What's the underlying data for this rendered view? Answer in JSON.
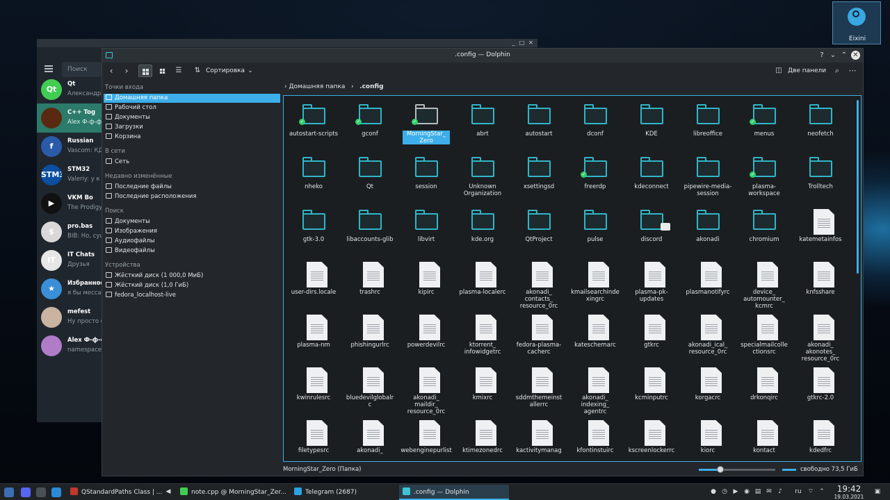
{
  "desktop": {
    "user_name": "Eixini"
  },
  "telegram": {
    "search_placeholder": "Поиск",
    "chats": [
      {
        "name": "Qt",
        "message": "Александр:",
        "avatar_text": "Qt",
        "color": "#41cd52"
      },
      {
        "name": "C++ Tog",
        "message": "Alex Ф-ф-ф",
        "avatar_text": "",
        "color": "#5a2a10"
      },
      {
        "name": "Russian",
        "message": "Vascom: КД",
        "avatar_text": "f",
        "color": "#2b5aa8"
      },
      {
        "name": "STM32",
        "message": "Valeriy: у к",
        "avatar_text": "STM32",
        "color": "#0a4fa0"
      },
      {
        "name": "VKM Bo",
        "message": "The Prodigy",
        "avatar_text": "▶",
        "color": "#111111"
      },
      {
        "name": "pro.bas",
        "message": "BIB: Но, суц",
        "avatar_text": "$",
        "color": "#d8d8d8"
      },
      {
        "name": "IT Chats",
        "message": "Друзья",
        "avatar_text": "IT",
        "color": "#e6e6e6"
      },
      {
        "name": "Избранное",
        "message": "я бы мессаг",
        "avatar_text": "★",
        "color": "#3a8fd6"
      },
      {
        "name": "mefest",
        "message": "Ну просто с",
        "avatar_text": "",
        "color": "#c8b4a0"
      },
      {
        "name": "Alex Ф-ф-ф",
        "message": "namespace",
        "avatar_text": "",
        "color": "#b07cc8"
      }
    ]
  },
  "dolphin": {
    "title": ".config — Dolphin",
    "sort_label": "Сортировка",
    "split_label": "Две панели",
    "breadcrumb": {
      "home": "Домашняя папка",
      "current": ".config"
    },
    "places": {
      "entry_points": "Точки входа",
      "items_main": [
        "Домашняя папка",
        "Рабочий стол",
        "Документы",
        "Загрузки",
        "Корзина"
      ],
      "network": "В сети",
      "items_network": [
        "Сеть"
      ],
      "recent": "Недавно изменённые",
      "items_recent": [
        "Последние файлы",
        "Последние расположения"
      ],
      "search": "Поиск",
      "items_search": [
        "Документы",
        "Изображения",
        "Аудиофайлы",
        "Видеофайлы"
      ],
      "devices": "Устройства",
      "items_devices": [
        "Жёсткий диск (1 000,0 МиБ)",
        "Жёсткий диск (1,0 ГиБ)",
        "fedora_localhost-live"
      ]
    },
    "status_text": "MorningStar_Zero (Папка)",
    "free_space": "свободно 73,5 ГиБ",
    "zoom_fraction": 0.28,
    "items": [
      {
        "name": "autostart-scripts",
        "type": "folder",
        "synced": true
      },
      {
        "name": "gconf",
        "type": "folder",
        "synced": true
      },
      {
        "name": "MorningStar_\nZero",
        "type": "folder",
        "synced": true,
        "selected": true
      },
      {
        "name": "abrt",
        "type": "folder"
      },
      {
        "name": "autostart",
        "type": "folder"
      },
      {
        "name": "dconf",
        "type": "folder"
      },
      {
        "name": "KDE",
        "type": "folder"
      },
      {
        "name": "libreoffice",
        "type": "folder"
      },
      {
        "name": "menus",
        "type": "folder",
        "synced": true
      },
      {
        "name": "neofetch",
        "type": "folder"
      },
      {
        "name": "nheko",
        "type": "folder"
      },
      {
        "name": "Qt",
        "type": "folder"
      },
      {
        "name": "session",
        "type": "folder"
      },
      {
        "name": "Unknown\nOrganization",
        "type": "folder"
      },
      {
        "name": "xsettingsd",
        "type": "folder"
      },
      {
        "name": "freerdp",
        "type": "folder",
        "synced": true
      },
      {
        "name": "kdeconnect",
        "type": "folder"
      },
      {
        "name": "pipewire-media-\nsession",
        "type": "folder"
      },
      {
        "name": "plasma-\nworkspace",
        "type": "folder",
        "synced": true
      },
      {
        "name": "Trolltech",
        "type": "folder"
      },
      {
        "name": "gtk-3.0",
        "type": "folder"
      },
      {
        "name": "libaccounts-glib",
        "type": "folder"
      },
      {
        "name": "libvirt",
        "type": "folder"
      },
      {
        "name": "kde.org",
        "type": "folder"
      },
      {
        "name": "QtProject",
        "type": "folder"
      },
      {
        "name": "pulse",
        "type": "folder"
      },
      {
        "name": "discord",
        "type": "folder",
        "discord": true
      },
      {
        "name": "akonadi",
        "type": "folder"
      },
      {
        "name": "chromium",
        "type": "folder"
      },
      {
        "name": "katemetainfos",
        "type": "file"
      },
      {
        "name": "user-dirs.locale",
        "type": "file"
      },
      {
        "name": "trashrc",
        "type": "file"
      },
      {
        "name": "kipirc",
        "type": "file"
      },
      {
        "name": "plasma-localerc",
        "type": "file"
      },
      {
        "name": "akonadi_\ncontacts_\nresource_0rc",
        "type": "file"
      },
      {
        "name": "kmailsearchinde\nxingrc",
        "type": "file"
      },
      {
        "name": "plasma-pk-\nupdates",
        "type": "file"
      },
      {
        "name": "plasmanotifyrc",
        "type": "file"
      },
      {
        "name": "device_\nautomounter_\nkcmrc",
        "type": "file"
      },
      {
        "name": "knfsshare",
        "type": "file"
      },
      {
        "name": "plasma-nm",
        "type": "file"
      },
      {
        "name": "phishingurlrc",
        "type": "file"
      },
      {
        "name": "powerdevilrc",
        "type": "file"
      },
      {
        "name": "ktorrent_\ninfowidgetrc",
        "type": "file"
      },
      {
        "name": "fedora-plasma-\ncacherc",
        "type": "file"
      },
      {
        "name": "kateschemarc",
        "type": "file"
      },
      {
        "name": "gtkrc",
        "type": "file"
      },
      {
        "name": "akonadi_ical_\nresource_0rc",
        "type": "file"
      },
      {
        "name": "specialmailcolle\nctionsrc",
        "type": "file"
      },
      {
        "name": "akonadi_\nakonotes_\nresource_0rc",
        "type": "file"
      },
      {
        "name": "kwinrulesrc",
        "type": "file"
      },
      {
        "name": "bluedevilglobalr\nc",
        "type": "file"
      },
      {
        "name": "akonadi_\nmaildir_\nresource_0rc",
        "type": "file"
      },
      {
        "name": "kmixrc",
        "type": "file"
      },
      {
        "name": "sddmthemeinst\nallerrc",
        "type": "file"
      },
      {
        "name": "akonadi_\nindexing_\nagentrc",
        "type": "file"
      },
      {
        "name": "kcminputrc",
        "type": "file"
      },
      {
        "name": "korgacrc",
        "type": "file"
      },
      {
        "name": "drkonqirc",
        "type": "file"
      },
      {
        "name": "gtkrc-2.0",
        "type": "file"
      },
      {
        "name": "filetypesrc",
        "type": "file"
      },
      {
        "name": "akonadi_",
        "type": "file"
      },
      {
        "name": "webenginepurlist",
        "type": "file"
      },
      {
        "name": "ktimezonedrc",
        "type": "file"
      },
      {
        "name": "kactivitymanag",
        "type": "file"
      },
      {
        "name": "kfontinstuirc",
        "type": "file"
      },
      {
        "name": "kscreenlockerrc",
        "type": "file"
      },
      {
        "name": "kiorc",
        "type": "file"
      },
      {
        "name": "kontact",
        "type": "file"
      },
      {
        "name": "kdedfrc",
        "type": "file"
      }
    ]
  },
  "taskbar": {
    "tasks": [
      {
        "label": "QStandardPaths Class | ...",
        "color": "#c0392b"
      },
      {
        "label": "note.cpp @ MorningStar_Zer...",
        "color": "#41cd52"
      },
      {
        "label": "Telegram (2687)",
        "color": "#2aa3de"
      },
      {
        "label": ".config — Dolphin",
        "color": "#3ec4d4"
      }
    ],
    "lang": "ru",
    "time": "19:42",
    "date": "19.03.2021"
  }
}
